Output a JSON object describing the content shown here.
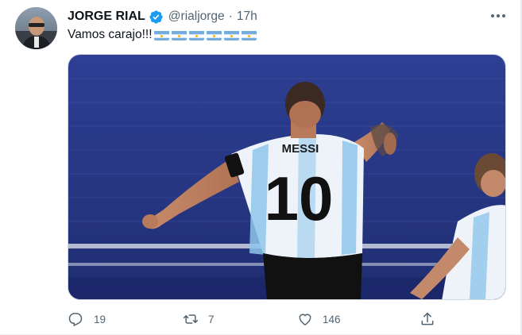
{
  "author": {
    "display_name": "JORGE RIAL",
    "handle": "@rialjorge",
    "separator": "·",
    "timestamp": "17h",
    "verified": true
  },
  "tweet": {
    "text": "Vamos carajo!!!",
    "flag_emoji_count": 6,
    "media_description": "photo",
    "jersey_name": "MESSI",
    "jersey_number": "10"
  },
  "actions": {
    "replies": "19",
    "retweets": "7",
    "likes": "146"
  },
  "colors": {
    "text_primary": "#0f1419",
    "text_secondary": "#536471",
    "verified_blue": "#1d9bf0",
    "pitch_blue": "#2b3a8a"
  },
  "icons": {
    "more": "more-icon",
    "verified": "verified-badge-icon",
    "reply": "reply-icon",
    "retweet": "retweet-icon",
    "like": "heart-icon",
    "share": "share-icon"
  }
}
